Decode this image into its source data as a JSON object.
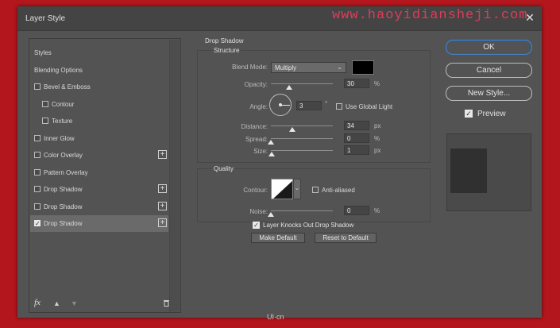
{
  "window": {
    "title": "Layer Style",
    "watermark": "www.haoyidiansheji.com"
  },
  "styles_list": {
    "items": [
      {
        "label": "Styles",
        "checkbox": false,
        "checked": false,
        "plus": false,
        "indent": 0
      },
      {
        "label": "Blending Options",
        "checkbox": false,
        "checked": false,
        "plus": false,
        "indent": 0
      },
      {
        "label": "Bevel & Emboss",
        "checkbox": true,
        "checked": false,
        "plus": false,
        "indent": 0
      },
      {
        "label": "Contour",
        "checkbox": true,
        "checked": false,
        "plus": false,
        "indent": 1
      },
      {
        "label": "Texture",
        "checkbox": true,
        "checked": false,
        "plus": false,
        "indent": 1
      },
      {
        "label": "Inner Glow",
        "checkbox": true,
        "checked": false,
        "plus": false,
        "indent": 0
      },
      {
        "label": "Color Overlay",
        "checkbox": true,
        "checked": false,
        "plus": true,
        "indent": 0
      },
      {
        "label": "Pattern Overlay",
        "checkbox": true,
        "checked": false,
        "plus": false,
        "indent": 0
      },
      {
        "label": "Drop Shadow",
        "checkbox": true,
        "checked": false,
        "plus": true,
        "indent": 0
      },
      {
        "label": "Drop Shadow",
        "checkbox": true,
        "checked": false,
        "plus": true,
        "indent": 0
      },
      {
        "label": "Drop Shadow",
        "checkbox": true,
        "checked": true,
        "plus": true,
        "indent": 0,
        "selected": true
      }
    ],
    "plus_glyph": "+",
    "footer": {
      "fx": "fx",
      "up": "▲",
      "down": "▼",
      "trash": "🗑"
    }
  },
  "drop_shadow": {
    "section_title": "Drop Shadow",
    "structure_title": "Structure",
    "blend_mode_label": "Blend Mode:",
    "blend_mode_value": "Multiply",
    "shadow_color": "#000000",
    "opacity_label": "Opacity:",
    "opacity_value": "30",
    "opacity_fraction": 0.3,
    "opacity_unit": "%",
    "angle_label": "Angle:",
    "angle_value": "3",
    "angle_unit": "°",
    "use_global_light_label": "Use Global Light",
    "distance_label": "Distance:",
    "distance_value": "34",
    "distance_fraction": 0.34,
    "distance_unit": "px",
    "spread_label": "Spread:",
    "spread_value": "0",
    "spread_unit": "%",
    "size_label": "Size:",
    "size_value": "1",
    "size_unit": "px",
    "quality_title": "Quality",
    "contour_label": "Contour:",
    "anti_aliased_label": "Anti-aliased",
    "noise_label": "Noise:",
    "noise_value": "0",
    "noise_unit": "%",
    "knocks_out_label": "Layer Knocks Out Drop Shadow",
    "make_default_label": "Make Default",
    "reset_default_label": "Reset to Default"
  },
  "actions": {
    "ok_label": "OK",
    "cancel_label": "Cancel",
    "new_style_label": "New Style...",
    "preview_label": "Preview"
  },
  "footer_mark": "UI·cn",
  "colors": {
    "background_red": "#b3161c",
    "dialog_gray": "#535353",
    "ok_accent": "#4a82c4"
  }
}
